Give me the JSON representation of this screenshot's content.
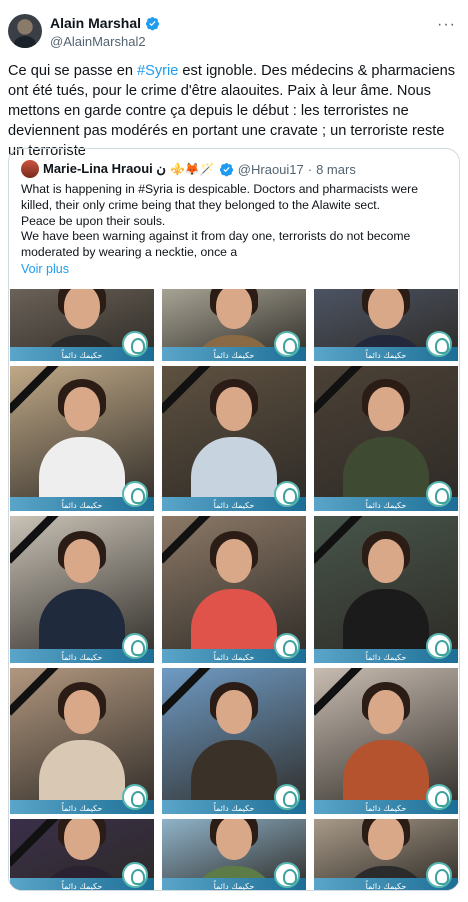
{
  "tweet": {
    "author_name": "Alain Marshal",
    "author_handle": "@AlainMarshal2",
    "more_icon": "ellipsis-icon",
    "text_before": "Ce qui se passe en ",
    "hashtag": "#Syrie",
    "text_after": " est ignoble. Des médecins & pharmaciens ont été tués, pour le crime d'être alaouites. Paix à leur âme. Nous mettons en garde contre ça depuis le début : les terroristes ne deviennent pas modérés en portant une cravate ; un terroriste reste un terroriste"
  },
  "quote": {
    "author_name": "Marie-Lina Hraoui ن",
    "author_emojis": "⚜️🦊🪄",
    "author_handle": "@Hraoui17",
    "separator": "·",
    "date": "8 mars",
    "lines": [
      "What is happening in #Syria is despicable. Doctors and pharmacists were killed, their only crime being that they belonged to the Alawite sect.",
      "Peace be upon their souls.",
      "We have been warning against it from day one, terrorists do not become moderated by wearing a necktie, once a"
    ],
    "show_more": "Voir plus"
  },
  "grid": {
    "banner_text": "حكيمك دائماً",
    "tiles": [
      {
        "bg": "#6b6258",
        "shirt": "#2a2a2a",
        "ribbon": false
      },
      {
        "bg": "#a7a394",
        "shirt": "#8a6a44",
        "ribbon": false
      },
      {
        "bg": "#4c5463",
        "shirt": "#23283a",
        "ribbon": false
      },
      {
        "bg": "#bfa887",
        "shirt": "#eeeeee",
        "ribbon": true
      },
      {
        "bg": "#5e5140",
        "shirt": "#c7d3de",
        "ribbon": true
      },
      {
        "bg": "#4b4136",
        "shirt": "#3f4a33",
        "ribbon": true
      },
      {
        "bg": "#c9c2b6",
        "shirt": "#1f2a3c",
        "ribbon": true
      },
      {
        "bg": "#8c7967",
        "shirt": "#e0534b",
        "ribbon": true
      },
      {
        "bg": "#47554a",
        "shirt": "#1b1b1b",
        "ribbon": true
      },
      {
        "bg": "#b1977f",
        "shirt": "#d9c8b3",
        "ribbon": true
      },
      {
        "bg": "#6f9bc4",
        "shirt": "#3a3229",
        "ribbon": true
      },
      {
        "bg": "#c8bcb1",
        "shirt": "#b4532e",
        "ribbon": true
      },
      {
        "bg": "#3a2f4a",
        "shirt": "#2a2230",
        "ribbon": true
      },
      {
        "bg": "#8fb3c9",
        "shirt": "#5d7b47",
        "ribbon": false
      },
      {
        "bg": "#a89a88",
        "shirt": "#2b2b2b",
        "ribbon": false
      }
    ]
  }
}
